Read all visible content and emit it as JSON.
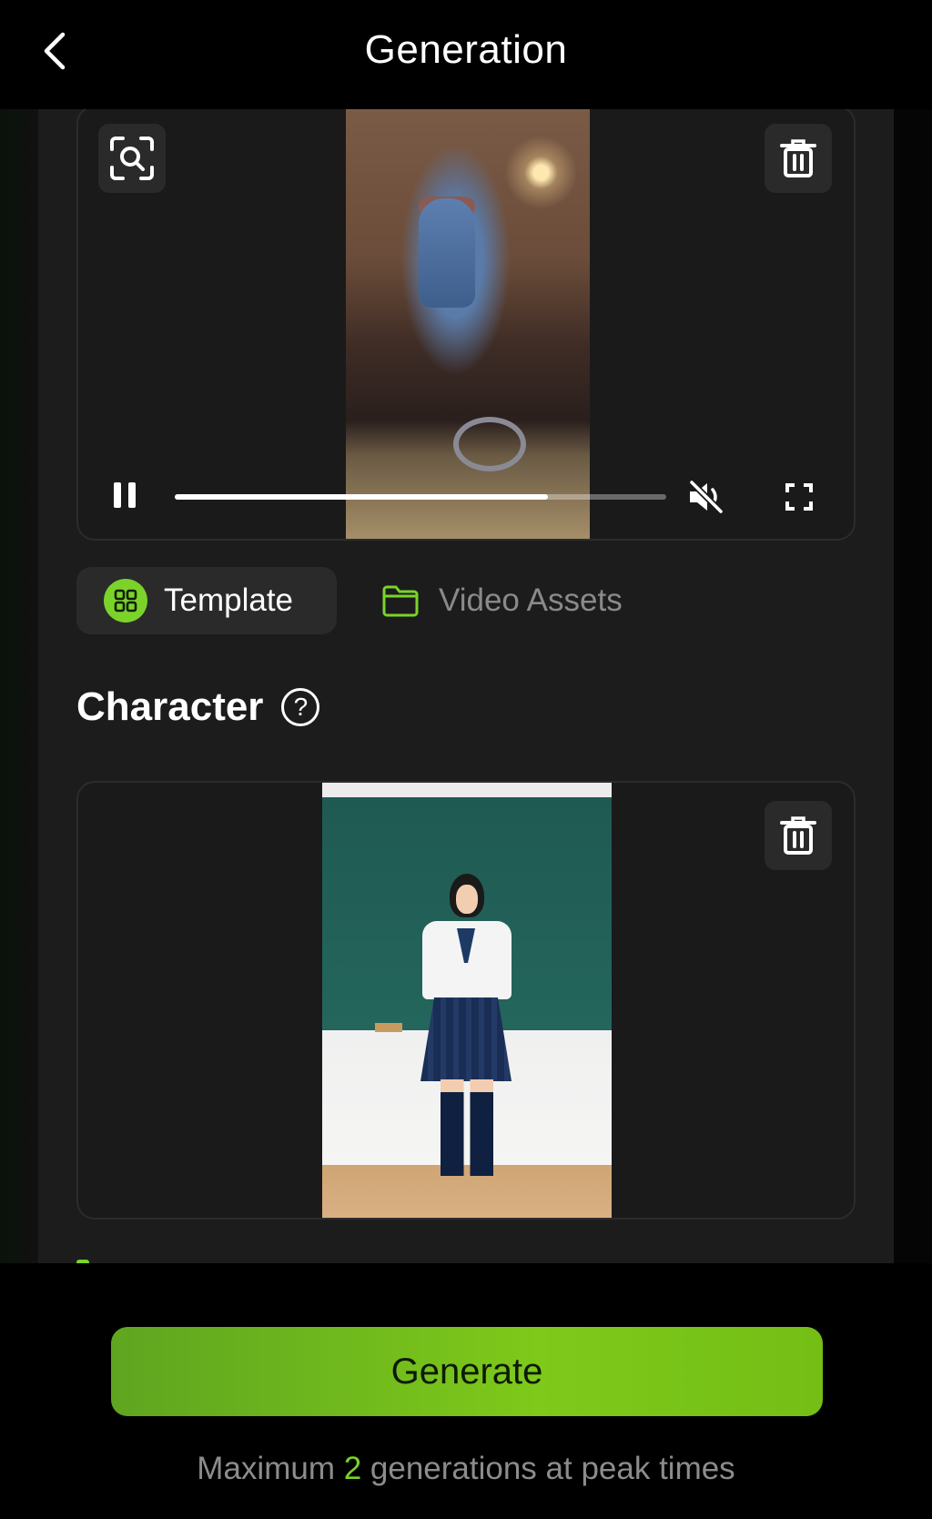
{
  "header": {
    "title": "Generation",
    "back_icon": "chevron-left-icon"
  },
  "video": {
    "scan_icon": "scan-search-icon",
    "delete_icon": "trash-icon",
    "controls": {
      "pause_icon": "pause-icon",
      "progress": 0.76,
      "mute_icon": "volume-mute-icon",
      "fullscreen_icon": "fullscreen-icon"
    }
  },
  "tabs": [
    {
      "label": "Template",
      "icon": "grid-icon",
      "selected": true
    },
    {
      "label": "Video Assets",
      "icon": "folder-icon",
      "selected": false
    }
  ],
  "character": {
    "title": "Character",
    "help_icon": "help-icon",
    "help_glyph": "?",
    "delete_icon": "trash-icon"
  },
  "generate": {
    "label": "Generate",
    "note_prefix": "Maximum ",
    "note_count": "2",
    "note_suffix": " generations at peak times"
  },
  "colors": {
    "accent": "#7bd32a",
    "panel": "#1c1c1c",
    "background": "#000000"
  }
}
